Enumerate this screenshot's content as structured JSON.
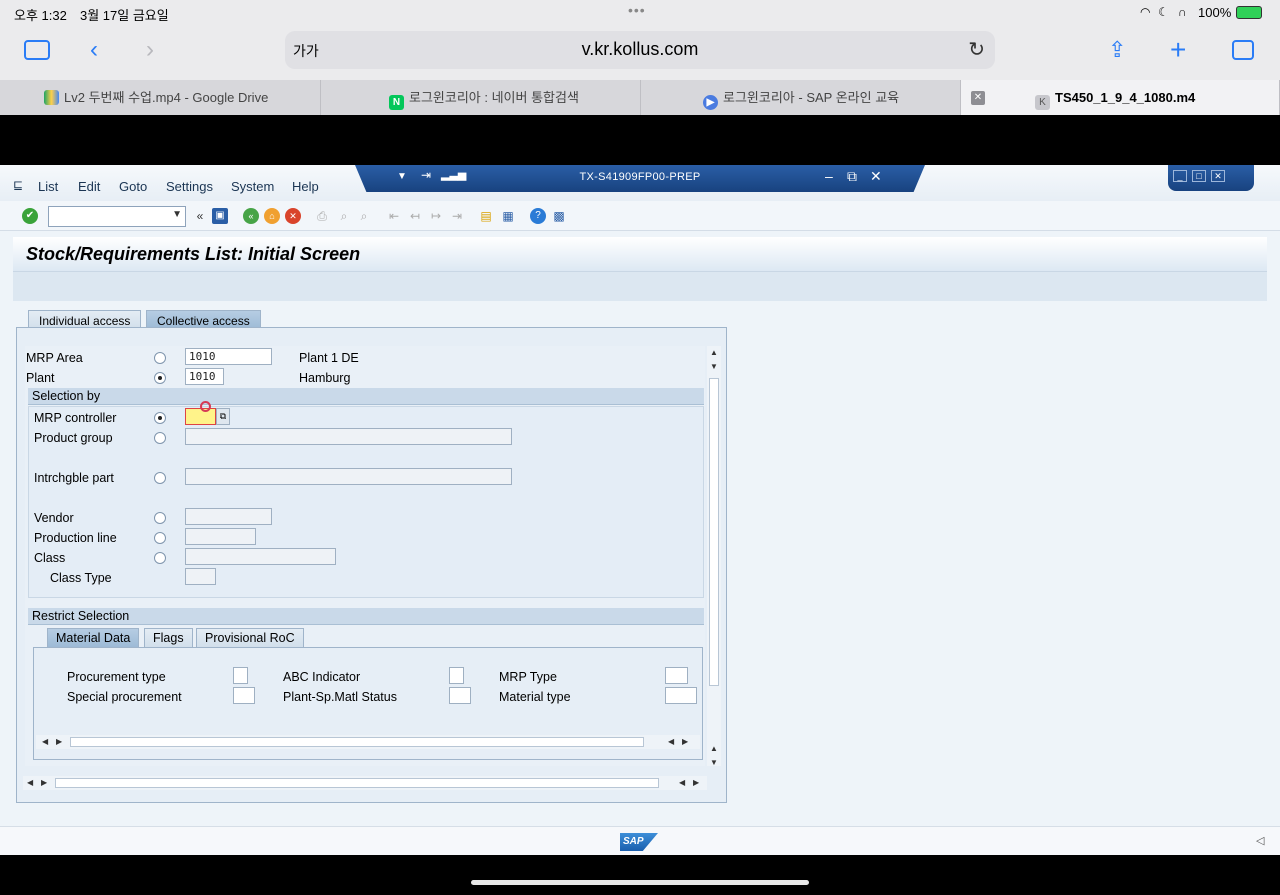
{
  "status": {
    "time": "오후 1:32",
    "date": "3월 17일 금요일",
    "battery": "100%"
  },
  "safari": {
    "text_size": "가가",
    "host": "v.kr.kollus.com"
  },
  "tabs": [
    {
      "label": "Lv2 두번째 수업.mp4 - Google Drive"
    },
    {
      "label": "로그윈코리아 : 네이버 통합검색"
    },
    {
      "label": "로그윈코리아 - SAP 온라인 교육"
    },
    {
      "label": "TS450_1_9_4_1080.m4"
    }
  ],
  "sap": {
    "menu": [
      "List",
      "Edit",
      "Goto",
      "Settings",
      "System",
      "Help"
    ],
    "system_id": "TX-S41909FP00-PREP",
    "screen_title": "Stock/Requirements List: Initial Screen",
    "main_tabs": [
      "Individual access",
      "Collective access"
    ],
    "mrp_area": {
      "label": "MRP Area",
      "value": "1010",
      "desc": "Plant 1 DE"
    },
    "plant": {
      "label": "Plant",
      "value": "1010",
      "desc": "Hamburg"
    },
    "selection_by": {
      "title": "Selection by",
      "mrp_controller": "MRP controller",
      "product_group": "Product group",
      "intrchgble_part": "Intrchgble part",
      "vendor": "Vendor",
      "production_line": "Production line",
      "class": "Class",
      "class_type": "Class Type"
    },
    "restrict": {
      "title": "Restrict Selection",
      "tabs": [
        "Material Data",
        "Flags",
        "Provisional RoC"
      ],
      "procurement_type": "Procurement type",
      "special_procurement": "Special procurement",
      "abc_indicator": "ABC Indicator",
      "plant_sp_status": "Plant-Sp.Matl Status",
      "mrp_type": "MRP Type",
      "material_type": "Material type"
    },
    "logo": "SAP"
  },
  "colors": {
    "sap_blue": "#18427f",
    "accent": "#2a7cf6"
  }
}
